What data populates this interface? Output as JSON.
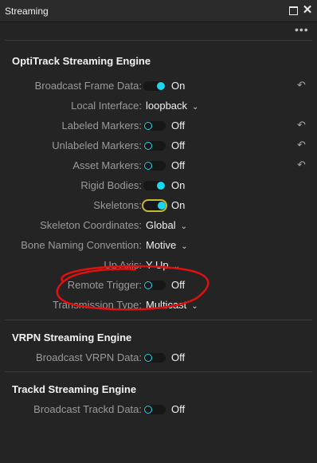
{
  "window": {
    "title": "Streaming"
  },
  "icons": {
    "maximize": "maximize-icon",
    "close": "close-icon",
    "more": "more-options-icon",
    "reset": "reset-icon",
    "chevron": "chevron-down-icon"
  },
  "colors": {
    "accent": "#19d8f0",
    "highlight": "#c8b830",
    "annotation": "#e01010"
  },
  "optitrack": {
    "title": "OptiTrack Streaming Engine",
    "broadcast_frame_data": {
      "label": "Broadcast Frame Data:",
      "state": "On"
    },
    "local_interface": {
      "label": "Local Interface:",
      "value": "loopback"
    },
    "labeled_markers": {
      "label": "Labeled Markers:",
      "state": "Off"
    },
    "unlabeled_markers": {
      "label": "Unlabeled Markers:",
      "state": "Off"
    },
    "asset_markers": {
      "label": "Asset Markers:",
      "state": "Off"
    },
    "rigid_bodies": {
      "label": "Rigid Bodies:",
      "state": "On"
    },
    "skeletons": {
      "label": "Skeletons:",
      "state": "On"
    },
    "skeleton_coordinates": {
      "label": "Skeleton Coordinates:",
      "value": "Global"
    },
    "bone_naming": {
      "label": "Bone Naming Convention:",
      "value": "Motive"
    },
    "up_axis": {
      "label": "Up Axis:",
      "value": "Y Up"
    },
    "remote_trigger": {
      "label": "Remote Trigger:",
      "state": "Off"
    },
    "transmission_type": {
      "label": "Transmission Type:",
      "value": "Multicast"
    }
  },
  "vrpn": {
    "title": "VRPN Streaming Engine",
    "broadcast_vrpn_data": {
      "label": "Broadcast VRPN Data:",
      "state": "Off"
    }
  },
  "trackd": {
    "title": "Trackd Streaming Engine",
    "broadcast_trackd_data": {
      "label": "Broadcast Trackd Data:",
      "state": "Off"
    }
  }
}
